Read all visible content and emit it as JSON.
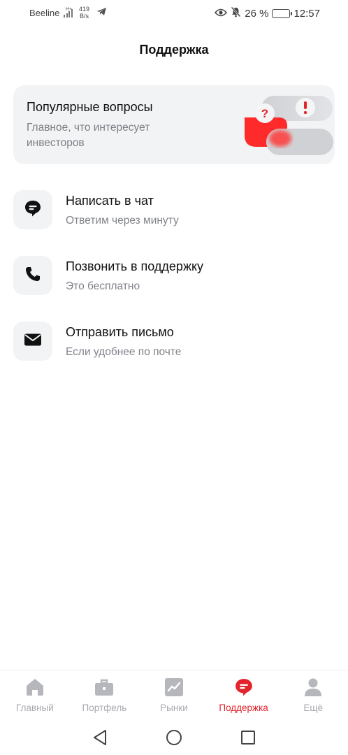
{
  "status_bar": {
    "carrier": "Beeline",
    "network": "H+",
    "speed_value": "419",
    "speed_unit": "B/s",
    "battery_percent": "26 %",
    "battery_level": 0.26,
    "time": "12:57"
  },
  "header": {
    "title": "Поддержка"
  },
  "faq_card": {
    "title": "Популярные вопросы",
    "subtitle": "Главное, что интересует инвесторов"
  },
  "support_items": [
    {
      "title": "Написать в чат",
      "subtitle": "Ответим через минуту",
      "icon": "chat-icon"
    },
    {
      "title": "Позвонить в поддержку",
      "subtitle": "Это бесплатно",
      "icon": "phone-icon"
    },
    {
      "title": "Отправить письмо",
      "subtitle": "Если удобнее по почте",
      "icon": "mail-icon"
    }
  ],
  "bottom_nav": {
    "items": [
      {
        "label": "Главный",
        "icon": "home-icon",
        "active": false
      },
      {
        "label": "Портфель",
        "icon": "briefcase-icon",
        "active": false
      },
      {
        "label": "Рынки",
        "icon": "chart-icon",
        "active": false
      },
      {
        "label": "Поддержка",
        "icon": "support-chat-icon",
        "active": true
      },
      {
        "label": "Ещё",
        "icon": "profile-icon",
        "active": false
      }
    ]
  },
  "colors": {
    "accent": "#e3242b",
    "card_bg": "#f2f3f5",
    "inactive": "#b5b7bc"
  }
}
